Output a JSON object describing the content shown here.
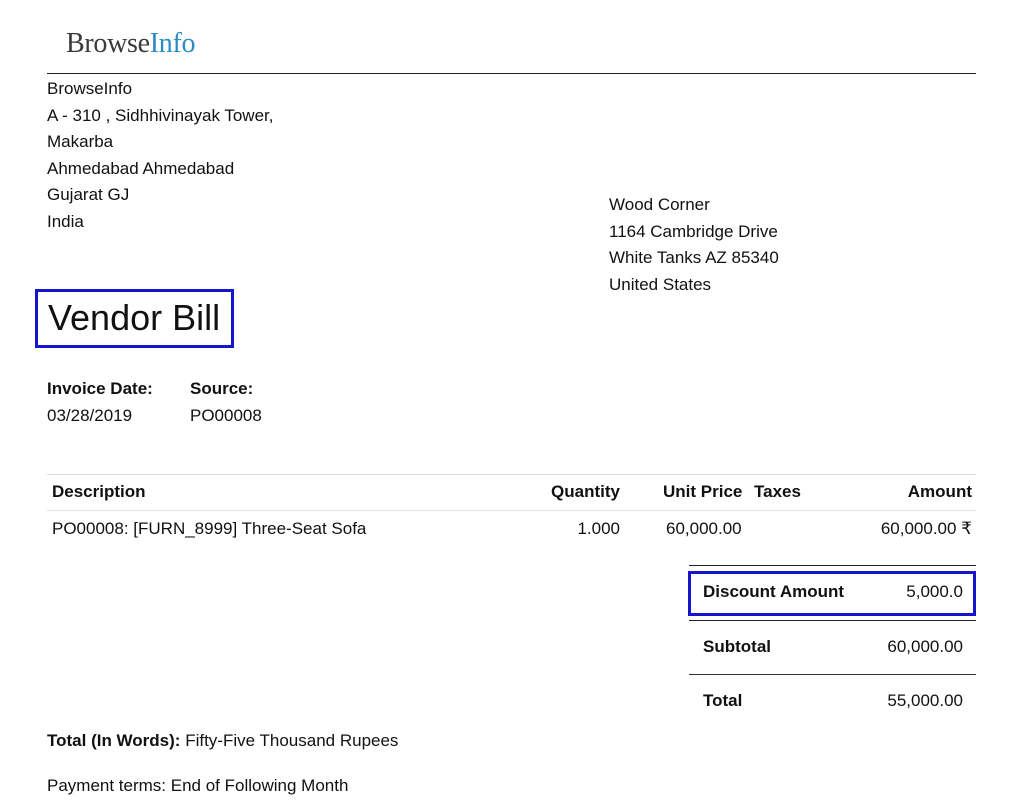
{
  "logo": {
    "brand_main": "Browse",
    "brand_accent": "Info"
  },
  "company": {
    "lines": [
      "BrowseInfo",
      "A - 310 , Sidhhivinayak Tower,",
      "Makarba",
      "Ahmedabad Ahmedabad",
      "Gujarat GJ",
      "India"
    ]
  },
  "partner": {
    "lines": [
      "Wood Corner",
      "1164 Cambridge Drive",
      "White Tanks AZ 85340",
      "United States"
    ]
  },
  "document": {
    "title": "Vendor Bill"
  },
  "info": {
    "invoice_date_label": "Invoice Date:",
    "invoice_date": "03/28/2019",
    "source_label": "Source:",
    "source": "PO00008"
  },
  "table": {
    "headers": {
      "description": "Description",
      "quantity": "Quantity",
      "unit_price": "Unit Price",
      "taxes": "Taxes",
      "amount": "Amount"
    },
    "rows": [
      {
        "description": "PO00008: [FURN_8999] Three-Seat Sofa",
        "quantity": "1.000",
        "unit_price": "60,000.00",
        "taxes": "",
        "amount": "60,000.00 ₹"
      }
    ]
  },
  "totals": {
    "discount_label": "Discount Amount",
    "discount_value": "5,000.0",
    "subtotal_label": "Subtotal",
    "subtotal_value": "60,000.00",
    "total_label": "Total",
    "total_value": "55,000.00"
  },
  "footer": {
    "words_label": "Total (In Words):",
    "words_value": "Fifty-Five Thousand Rupees",
    "payment_terms": "Payment terms: End of Following Month"
  },
  "colors": {
    "highlight_border": "#1515d0",
    "logo_accent": "#2b8cc4",
    "text": "#111111"
  }
}
